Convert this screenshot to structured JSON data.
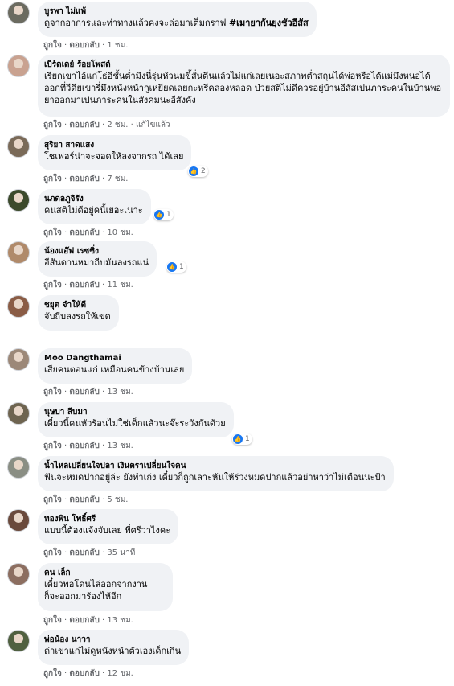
{
  "actions": {
    "like": "ถูกใจ",
    "reply": "ตอบกลับ",
    "sep": "·",
    "edited": "แก้ไขแล้ว"
  },
  "reaction_icon": "like-icon",
  "accent": "#1877f2",
  "comments": [
    {
      "author": "บูรพา ไม่แพ้",
      "text": "ดูจากอาการและท่าทางแล้วคงจะล่อมาเต็มกราฟ ",
      "hashtag": "#เมายากันยุงชัวอีสัส",
      "time": "1 ชม.",
      "avatar_color": "#6b6b60"
    },
    {
      "author": "เบิร์ดเดย์ ร้อยโพสต์",
      "text": "เรียกเขาไอ้แก่โธ่อีชั้นต่ำมึงนี่รุ่นหัวนมขี้สั่นตีนแล้วไม่แก่เลยเนอะสภาพต่ำสถุนได้พ่อหรือได้แม่มึงหนอได้ออกที่วีดียเขารี่มึงหนังหน้ากูเหยียดเลยกะหรีคลองหลอด ป่วยสติไม่ดีควรอยู่บ้านอีสัสเปนภาระคนในบ้านพอยาออกมาเปนภาระคนในสังคมนะอีสังคัง",
      "time": "2 ชม.",
      "edited": true,
      "avatar_color": "#c9a290"
    },
    {
      "author": "สุริยา สาดแสง",
      "text": "โชเฟอร์น่าจะจอดให้ลงจากรถ ได้เลย",
      "time": "7 ชม.",
      "reactions": "2",
      "avatar_color": "#7a6a58"
    },
    {
      "author": "นภดลภูจิรัง",
      "text": "คนสติไม่ดีอยู่คนี้เยอะเนาะ",
      "time": "10 ชม.",
      "reactions": "1",
      "avatar_color": "#3c4a2c"
    },
    {
      "author": "น้องแอ๊ฟ เรซซิ่ง",
      "text": "อีสันดานหมาถีบมันลงรถแน่",
      "time": "11 ชม.",
      "reactions": "1",
      "avatar_color": "#b08a6a"
    },
    {
      "author": "ชยุต จำให้ดี",
      "text": "จับถีบลงรถให้เขด",
      "time": "",
      "avatar_color": "#8a5c45"
    },
    {
      "author": "Moo Dangthamai",
      "text": "เสียคนตอนแก่ เหมือนคนข้างบ้านเลย",
      "time": "13 ชม.",
      "avatar_color": "#9c8878"
    },
    {
      "author": "นุษบา ลีบมา",
      "text": "เดี๋ยวนี้คนหัวร้อนไม่ใช่เด็กแล้วนะจ๊ะระวังกันด้วย",
      "time": "13 ชม.",
      "reactions": "1",
      "avatar_color": "#6e6450"
    },
    {
      "author": "น้ำไหลเปลี่ยนใจปลา เงินตราเปลี่ยนใจคน",
      "text": "ฟันจะหมดปากอยู่ล่ะ ยังทำเก่ง เดี๋ยวก็ถูกเลาะหันให้ร่วงหมดปากแล้วอย่าหาว่าไม่เตือนนะป้า",
      "time": "5 ชม.",
      "avatar_color": "#8a8e84"
    },
    {
      "author": "ทองพิน โพธิ์ศรี",
      "text": "แบบนี้ต้องแจ้งจับเลย พี่ศรีว่าไงคะ",
      "time": "35 นาที",
      "avatar_color": "#6a4a3c"
    },
    {
      "author": "คน เล็ก",
      "text": "เดี๋ยวพอโดนไล่ออกจากงาน\nก็จะออกมาร้องไห้อีก",
      "time": "13 ชม.",
      "avatar_color": "#8c6e60"
    },
    {
      "author": "พ่อน้อง นาวา",
      "text": "ด่าเขาแก่ไม่ดูหนังหน้าตัวเองเด็กเกิน",
      "time": "12 ชม.",
      "avatar_color": "#506040"
    }
  ]
}
